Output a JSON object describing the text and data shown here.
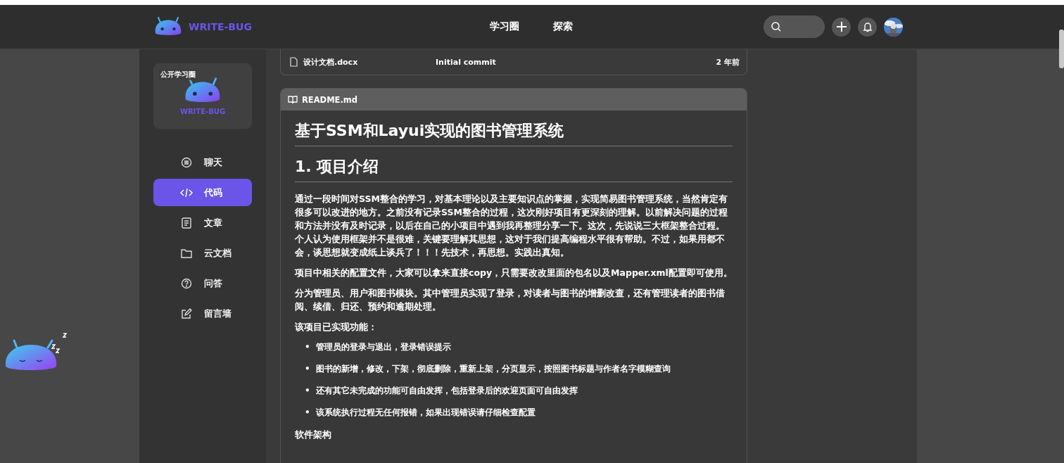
{
  "header": {
    "logo_text": "WRITE-BUG",
    "nav": [
      {
        "label": "学习圈",
        "selected": false
      },
      {
        "label": "探索",
        "selected": false
      }
    ]
  },
  "sidebar": {
    "group_card": {
      "badge": "公开学习圈",
      "logo_text": "WRITE-BUG"
    },
    "items": [
      {
        "label": "聊天",
        "selected": false
      },
      {
        "label": "代码",
        "selected": true
      },
      {
        "label": "文章",
        "selected": false
      },
      {
        "label": "云文档",
        "selected": false
      },
      {
        "label": "问答",
        "selected": false
      },
      {
        "label": "留言墙",
        "selected": false
      }
    ]
  },
  "files": [
    {
      "name": "设计文档.docx",
      "commit": "Initial commit",
      "time": "2 年前"
    }
  ],
  "readme": {
    "filename": "README.md",
    "blocks": [
      {
        "kind": "h1",
        "text": "基于SSM和Layui实现的图书管理系统"
      },
      {
        "kind": "h1",
        "text": "1. 项目介绍"
      },
      {
        "kind": "p",
        "text": "通过一段时间对SSM整合的学习，对基本理论以及主要知识点的掌握，实现简易图书管理系统，当然肯定有很多可以改进的地方。之前没有记录SSM整合的过程，这次刚好项目有更深刻的理解。以前解决问题的过程和方法并没有及时记录，以后在自己的小项目中遇到我再整理分享一下。这次，先说说三大框架整合过程。个人认为使用框架并不是很难，关键要理解其思想，这对于我们提高编程水平很有帮助。不过，如果用都不会，谈思想就变成纸上谈兵了！！！先技术，再思想。实践出真知。"
      },
      {
        "kind": "p",
        "text": "项目中相关的配置文件，大家可以拿来直接copy，只需要改改里面的包名以及Mapper.xml配置即可使用。"
      },
      {
        "kind": "p",
        "text": "分为管理员、用户和图书模块。其中管理员实现了登录，对读者与图书的增删改查，还有管理读者的图书借阅、续借、归还、预约和逾期处理。"
      },
      {
        "kind": "p",
        "text": "该项目已实现功能："
      },
      {
        "kind": "ul",
        "bullet": "•",
        "items": [
          "管理员的登录与退出，登录错误提示",
          "图书的新增，修改，下架，彻底删除，重新上架，分页显示，按照图书标题与作者名字模糊查询",
          "还有其它未完成的功能可自由发挥，包括登录后的欢迎页面可自由发挥",
          "该系统执行过程无任何报错，如果出现错误请仔细检查配置"
        ]
      },
      {
        "kind": "p",
        "text": "软件架构"
      }
    ]
  }
}
